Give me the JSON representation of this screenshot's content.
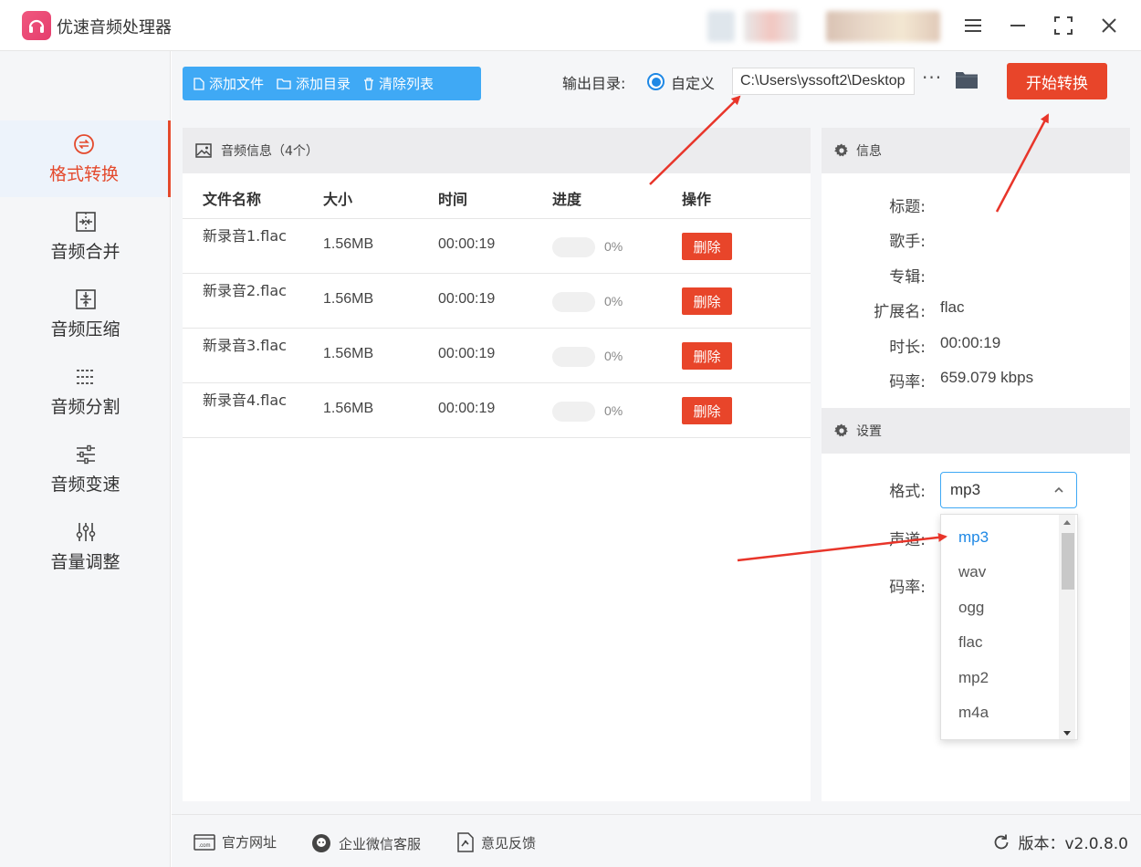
{
  "app": {
    "title": "优速音频处理器"
  },
  "sidebar": {
    "items": [
      {
        "label": "格式转换",
        "icon": "format-convert-icon",
        "active": true
      },
      {
        "label": "音频合并",
        "icon": "merge-icon"
      },
      {
        "label": "音频压缩",
        "icon": "compress-icon"
      },
      {
        "label": "音频分割",
        "icon": "split-icon"
      },
      {
        "label": "音频变速",
        "icon": "speed-icon"
      },
      {
        "label": "音量调整",
        "icon": "volume-adjust-icon"
      }
    ]
  },
  "toolbar": {
    "add_file": "添加文件",
    "add_dir": "添加目录",
    "clear_list": "清除列表",
    "output_label": "输出目录:",
    "output_mode": "自定义",
    "output_path": "C:\\Users\\yssoft2\\Desktop",
    "more": "···",
    "start": "开始转换"
  },
  "audio_panel": {
    "title": "音频信息（4个）",
    "columns": [
      "文件名称",
      "大小",
      "时间",
      "进度",
      "操作"
    ],
    "rows": [
      {
        "name": "新录音1.flac",
        "size": "1.56MB",
        "time": "00:00:19",
        "progress": "0%",
        "action": "删除"
      },
      {
        "name": "新录音2.flac",
        "size": "1.56MB",
        "time": "00:00:19",
        "progress": "0%",
        "action": "删除"
      },
      {
        "name": "新录音3.flac",
        "size": "1.56MB",
        "time": "00:00:19",
        "progress": "0%",
        "action": "删除"
      },
      {
        "name": "新录音4.flac",
        "size": "1.56MB",
        "time": "00:00:19",
        "progress": "0%",
        "action": "删除"
      }
    ]
  },
  "info": {
    "title": "信息",
    "fields": [
      {
        "key": "标题:",
        "value": ""
      },
      {
        "key": "歌手:",
        "value": ""
      },
      {
        "key": "专辑:",
        "value": ""
      },
      {
        "key": "扩展名:",
        "value": "flac"
      },
      {
        "key": "时长:",
        "value": "00:00:19"
      },
      {
        "key": "码率:",
        "value": "659.079 kbps"
      }
    ]
  },
  "settings": {
    "title": "设置",
    "format_label": "格式:",
    "channel_label": "声道:",
    "bitrate_label": "码率:",
    "format_value": "mp3",
    "format_options": [
      "mp3",
      "wav",
      "ogg",
      "flac",
      "mp2",
      "m4a"
    ]
  },
  "footer": {
    "website": "官方网址",
    "wechat": "企业微信客服",
    "feedback": "意见反馈",
    "version": "版本：v2.0.8.0"
  },
  "colors": {
    "accent_blue": "#3fa9f5",
    "accent_red": "#e8452a",
    "annotation_red": "#e8352a"
  }
}
